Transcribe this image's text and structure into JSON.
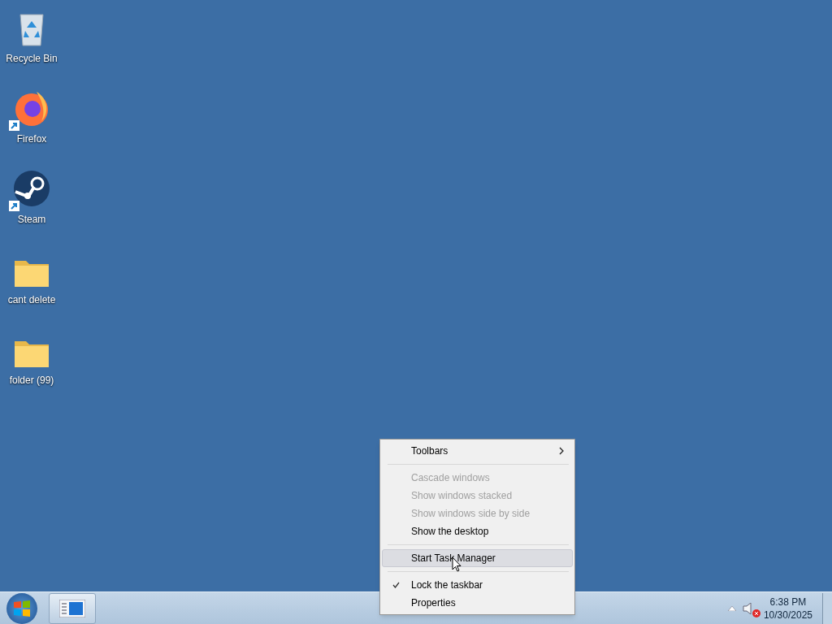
{
  "desktop_icons": [
    {
      "kind": "recycle",
      "label": "Recycle Bin",
      "shortcut": false
    },
    {
      "kind": "firefox",
      "label": "Firefox",
      "shortcut": true
    },
    {
      "kind": "steam",
      "label": "Steam",
      "shortcut": true
    },
    {
      "kind": "folder",
      "label": "cant delete",
      "shortcut": false
    },
    {
      "kind": "folder",
      "label": "folder (99)",
      "shortcut": false
    }
  ],
  "context_menu": [
    {
      "kind": "item",
      "label": "Toolbars",
      "disabled": false,
      "checked": false,
      "selected": false,
      "submenu": true
    },
    {
      "kind": "separator"
    },
    {
      "kind": "item",
      "label": "Cascade windows",
      "disabled": true,
      "checked": false,
      "selected": false,
      "submenu": false
    },
    {
      "kind": "item",
      "label": "Show windows stacked",
      "disabled": true,
      "checked": false,
      "selected": false,
      "submenu": false
    },
    {
      "kind": "item",
      "label": "Show windows side by side",
      "disabled": true,
      "checked": false,
      "selected": false,
      "submenu": false
    },
    {
      "kind": "item",
      "label": "Show the desktop",
      "disabled": false,
      "checked": false,
      "selected": false,
      "submenu": false
    },
    {
      "kind": "separator"
    },
    {
      "kind": "item",
      "label": "Start Task Manager",
      "disabled": false,
      "checked": false,
      "selected": true,
      "submenu": false
    },
    {
      "kind": "separator"
    },
    {
      "kind": "item",
      "label": "Lock the taskbar",
      "disabled": false,
      "checked": true,
      "selected": false,
      "submenu": false
    },
    {
      "kind": "item",
      "label": "Properties",
      "disabled": false,
      "checked": false,
      "selected": false,
      "submenu": false
    }
  ],
  "taskbar": {
    "clock_time": "6:38 PM",
    "clock_date": "10/30/2025",
    "volume_muted": true
  }
}
